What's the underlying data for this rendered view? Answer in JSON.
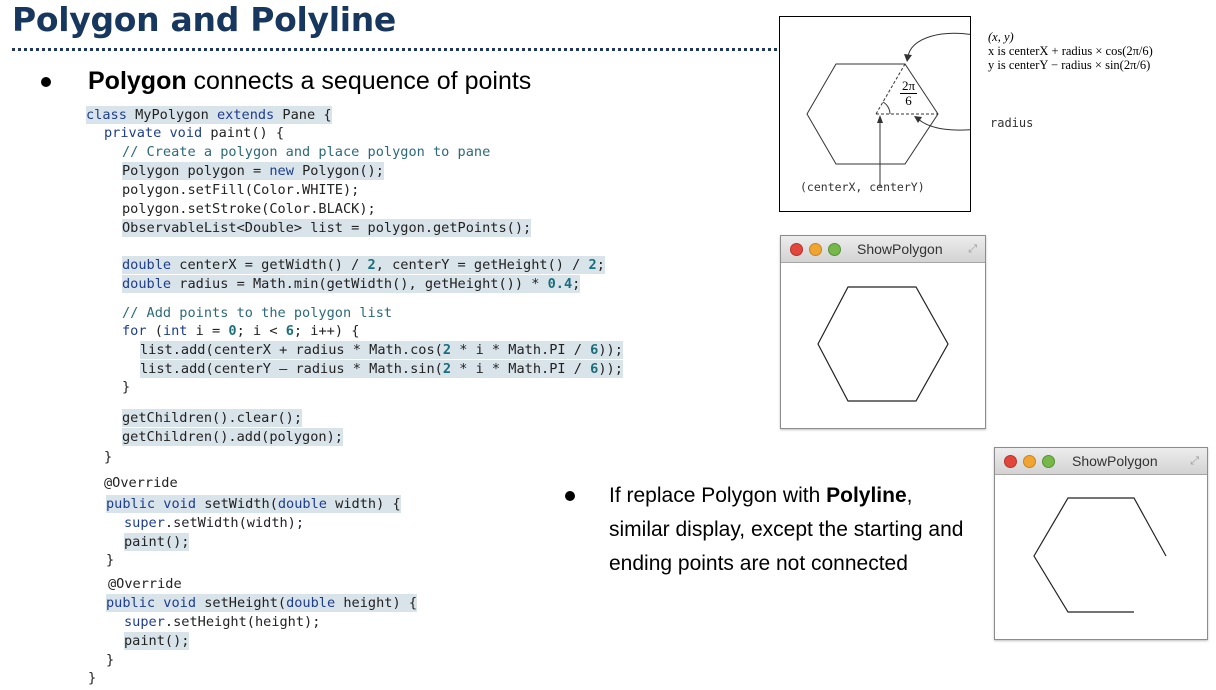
{
  "title": "Polygon and Polyline",
  "bullet1": {
    "bold": "Polygon",
    "rest": " connects a sequence of points"
  },
  "code": [
    {
      "text": "class MyPolygon extends Pane {"
    },
    {
      "text": "  private void paint() {"
    },
    {
      "text": "    // Create a polygon and place polygon to pane"
    },
    {
      "text": "    Polygon polygon = new Polygon();"
    },
    {
      "text": "    polygon.setFill(Color.WHITE);"
    },
    {
      "text": "    polygon.setStroke(Color.BLACK);"
    },
    {
      "text": "    ObservableList<Double> list = polygon.getPoints();"
    },
    {
      "text": "    double centerX = getWidth() / 2, centerY = getHeight() / 2;"
    },
    {
      "text": "    double radius = Math.min(getWidth(), getHeight()) * 0.4;"
    },
    {
      "text": "    // Add points to the polygon list"
    },
    {
      "text": "    for (int i = 0; i < 6; i++) {"
    },
    {
      "text": "      list.add(centerX + radius * Math.cos(2 * i * Math.PI / 6));"
    },
    {
      "text": "      list.add(centerY - radius * Math.sin(2 * i * Math.PI / 6));"
    },
    {
      "text": "    }"
    },
    {
      "text": "    getChildren().clear();"
    },
    {
      "text": "    getChildren().add(polygon);"
    },
    {
      "text": "  }"
    },
    {
      "text": "  @Override"
    },
    {
      "text": "  public void setWidth(double width) {"
    },
    {
      "text": "    super.setWidth(width);"
    },
    {
      "text": "    paint();"
    },
    {
      "text": "  }"
    },
    {
      "text": "  @Override"
    },
    {
      "text": "  public void setHeight(double height) {"
    },
    {
      "text": "    super.setHeight(height);"
    },
    {
      "text": "    paint();"
    },
    {
      "text": "  }"
    },
    {
      "text": "}"
    }
  ],
  "diagram": {
    "formula_line1": "(x, y)",
    "formula_line2": "x is centerX + radius × cos(2π/6)",
    "formula_line3": "y is centerY − radius × sin(2π/6)",
    "angle_num": "2π",
    "angle_den": "6",
    "radius_label": "radius",
    "center_label": "(centerX, centerY)"
  },
  "window1": {
    "title": "ShowPolygon"
  },
  "window2": {
    "title": "ShowPolygon"
  },
  "bullet2": {
    "pre": "If replace Polygon with ",
    "bold": "Polyline",
    "post": ", similar display, except the starting and ending points are not connected"
  },
  "colors": {
    "title": "#17375e",
    "highlight": "#d8e3ea",
    "keyword": "#1e3d8f"
  }
}
